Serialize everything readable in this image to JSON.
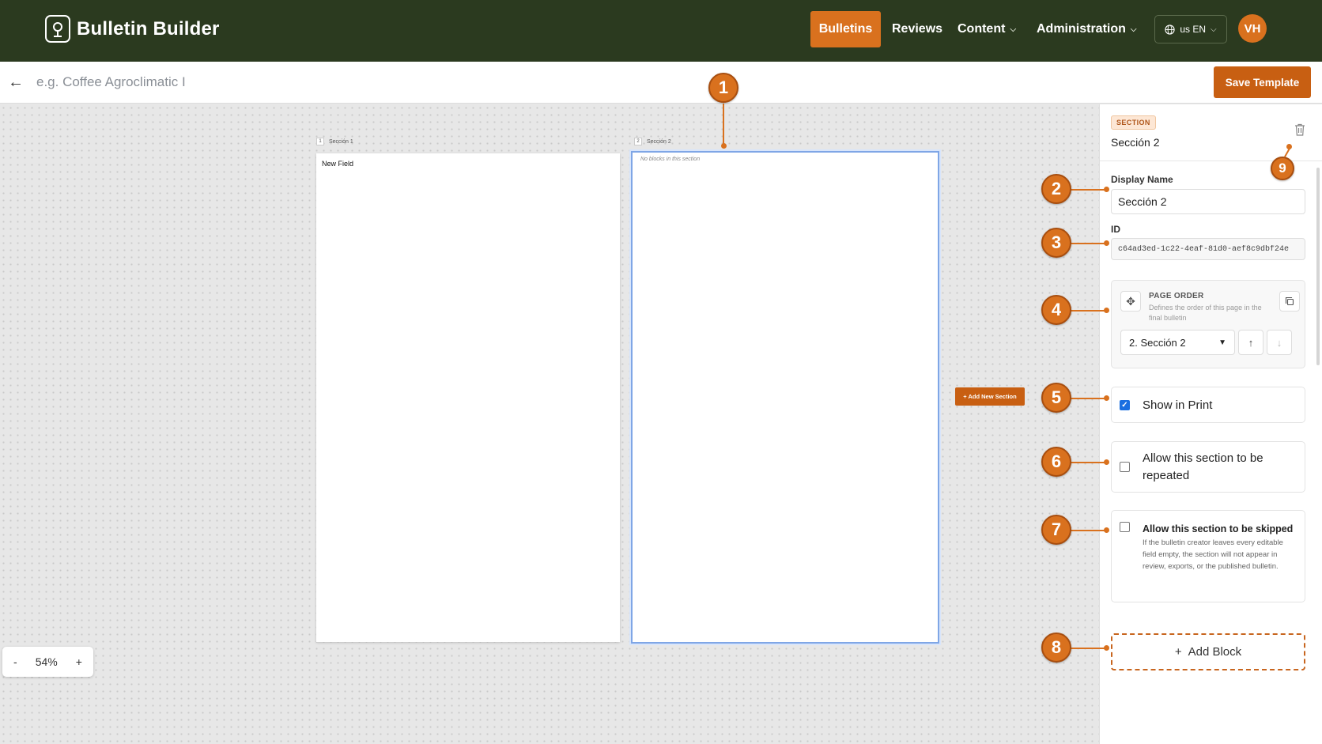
{
  "app": {
    "name": "Bulletin Builder"
  },
  "nav": {
    "bulletins": "Bulletins",
    "reviews": "Reviews",
    "content": "Content",
    "administration": "Administration",
    "language": "us EN",
    "avatar_initials": "VH"
  },
  "header": {
    "title_placeholder": "e.g. Coffee Agroclimatic I",
    "save_label": "Save Template"
  },
  "canvas": {
    "sections": [
      {
        "number": "1",
        "label": "Sección 1",
        "field": "New Field"
      },
      {
        "number": "2",
        "label": "Sección 2",
        "empty_text": "No blocks in this section"
      }
    ],
    "add_section_label": "+ Add New Section",
    "zoom": {
      "minus": "-",
      "value": "54%",
      "plus": "+"
    }
  },
  "panel": {
    "tag": "SECTION",
    "title": "Sección 2",
    "display_name_label": "Display Name",
    "display_name_value": "Sección 2",
    "id_label": "ID",
    "id_value": "c64ad3ed-1c22-4eaf-81d0-aef8c9dbf24e",
    "page_order": {
      "title": "PAGE ORDER",
      "description": "Defines the order of this page in the final bulletin",
      "selected": "2. Sección 2"
    },
    "show_in_print": {
      "label": "Show in Print",
      "checked": true
    },
    "repeat": {
      "label": "Allow this section to be repeated",
      "checked": false
    },
    "skip": {
      "label": "Allow this section to be skipped",
      "description": "If the bulletin creator leaves every editable field empty, the section will not appear in review, exports, or the published bulletin.",
      "checked": false
    },
    "add_block_label": "Add Block"
  },
  "callouts": [
    "1",
    "2",
    "3",
    "4",
    "5",
    "6",
    "7",
    "8",
    "9"
  ],
  "colors": {
    "topbar": "#2b3a1f",
    "accent": "#d9711e",
    "button": "#c85f12"
  }
}
